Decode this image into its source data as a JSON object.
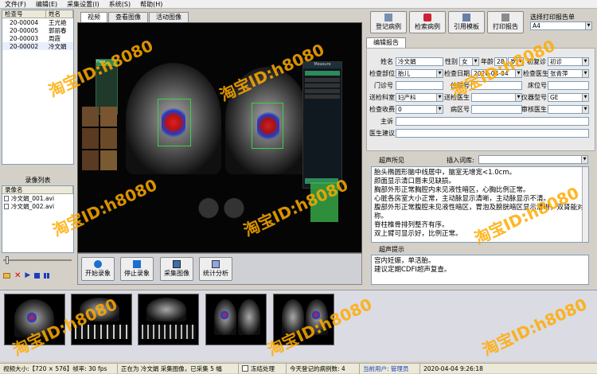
{
  "menu": [
    "文件(F)",
    "编辑(E)",
    "采集设置(I)",
    "系统(S)",
    "帮助(H)"
  ],
  "patient_list": {
    "headers": [
      "检查号",
      "姓名"
    ],
    "rows": [
      [
        "20-00004",
        "王光艳"
      ],
      [
        "20-00005",
        "郭丽春"
      ],
      [
        "20-00003",
        "周霞"
      ],
      [
        "20-00002",
        "冷文娟"
      ]
    ]
  },
  "recording": {
    "title": "录像列表",
    "header": "录像名",
    "items": [
      "冷文娟_001.avi",
      "冷文娟_002.avi"
    ]
  },
  "video_tabs": [
    "视频",
    "查看图像",
    "活动图像"
  ],
  "bottom_buttons": [
    "开始录象",
    "停止录象",
    "采集图像",
    "统计分析"
  ],
  "toolbar": {
    "buttons": [
      "登记病例",
      "检索病例",
      "引用模板",
      "打印报告"
    ],
    "print_template_label": "选择打印报告单",
    "print_template_value": "A4"
  },
  "report_tab": "编辑报告",
  "form": {
    "name_label": "姓名",
    "name": "冷文娟",
    "sex_label": "性别",
    "sex": "女",
    "age_label": "年龄",
    "age": "28",
    "age_unit": "岁",
    "visit_label": "初复诊",
    "visit": "初诊",
    "part_label": "检查部位",
    "part": "胎儿",
    "date_label": "检查日期",
    "date": "2020-04-04",
    "doctor_label": "检查医生",
    "doctor": "张青萍",
    "outpatient_label": "门诊号",
    "outpatient": "",
    "inpatient_label": "住院号",
    "inpatient": "",
    "bed_label": "床位号",
    "bed": "",
    "dept_label": "送检科室",
    "dept": "妇产科",
    "send_doctor_label": "送检医生",
    "send_doctor": "",
    "device_label": "仪器型号",
    "device": "GE",
    "fee_label": "检查收费",
    "fee": "0",
    "ward_label": "病区号",
    "ward": "",
    "reviewer_label": "审核医生",
    "reviewer": "",
    "complaint_label": "主诉",
    "complaint": "",
    "advice_label": "医生建议",
    "advice": ""
  },
  "findings": {
    "title": "超声所见",
    "insert_label": "插入词库:",
    "text": [
      "胎头椭圆形脑中线居中，脑室无增宽<1.0cm。",
      "颜面显示清口唇未见缺损。",
      "胸部外形正常胸腔内未见液性暗区，心胸比例正常。",
      "心脏各房室大小正常，主动脉显示清晰，主动脉显示不清。",
      "腹部外形正常腹腔未见液性暗区，胃泡及膀胱暗区显示清晰，双肾能对称。",
      "脊柱椎骨排列整齐有序。",
      "双上臂可显示好，比例正常。"
    ]
  },
  "impression": {
    "title": "超声提示",
    "text": [
      "宫内妊娠，单活胎。",
      "建议定期CDFI超声复查。"
    ]
  },
  "statusbar": {
    "video_size": "视频大小:【720 × 576】帧率: 30 fps",
    "status": "正在为 冷文娟 采集图像，已采集 5 幅",
    "freeze_label": "冻结处理",
    "today": "今天登记的病例数: 4",
    "user": "当前用户: 管理员",
    "datetime": "2020-04-04  9:26:18"
  },
  "ultrasound": {
    "tabs": [
      "Flow",
      "Gain"
    ],
    "right_header": "Measure",
    "right_items": [
      "Trace",
      "Auto",
      "Start",
      "Off",
      "Pause",
      "Sweep"
    ]
  },
  "watermark": "淘宝ID:h8080"
}
